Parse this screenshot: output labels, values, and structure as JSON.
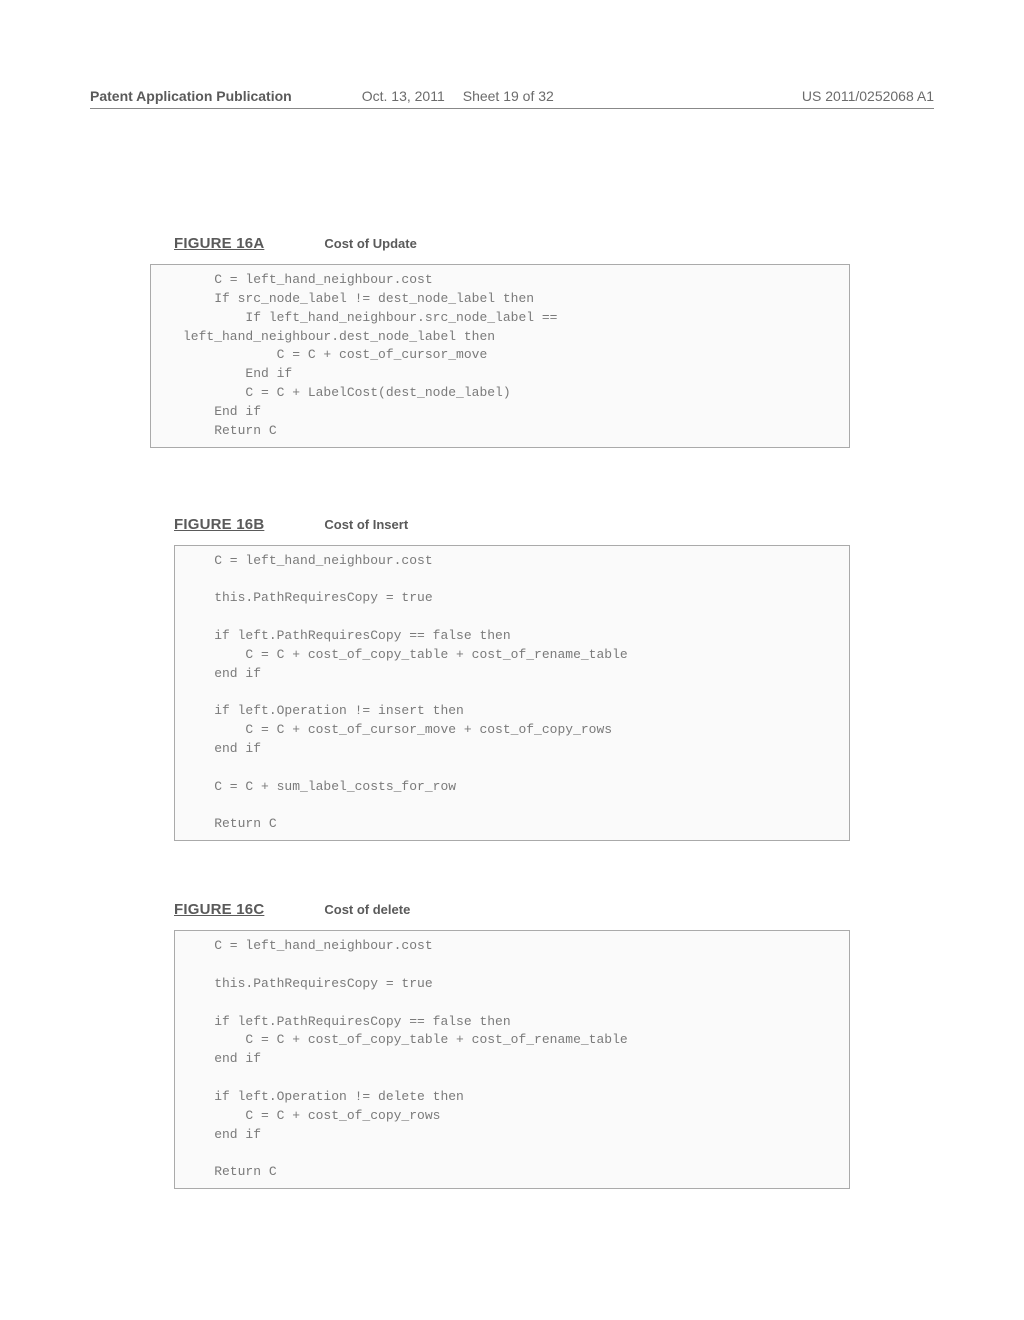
{
  "header": {
    "pub_type": "Patent Application Publication",
    "date": "Oct. 13, 2011",
    "sheet": "Sheet 19 of 32",
    "pubno": "US 2011/0252068 A1"
  },
  "figures": [
    {
      "label": "FIGURE 16A",
      "caption": "Cost of Update",
      "code": "    C = left_hand_neighbour.cost\n    If src_node_label != dest_node_label then\n        If left_hand_neighbour.src_node_label ==\nleft_hand_neighbour.dest_node_label then\n            C = C + cost_of_cursor_move\n        End if\n        C = C + LabelCost(dest_node_label)\n    End if\n    Return C"
    },
    {
      "label": "FIGURE 16B",
      "caption": "Cost of Insert",
      "code": "    C = left_hand_neighbour.cost\n\n    this.PathRequiresCopy = true\n\n    if left.PathRequiresCopy == false then\n        C = C + cost_of_copy_table + cost_of_rename_table\n    end if\n\n    if left.Operation != insert then\n        C = C + cost_of_cursor_move + cost_of_copy_rows\n    end if\n\n    C = C + sum_label_costs_for_row\n\n    Return C"
    },
    {
      "label": "FIGURE 16C",
      "caption": "Cost of delete",
      "code": "    C = left_hand_neighbour.cost\n\n    this.PathRequiresCopy = true\n\n    if left.PathRequiresCopy == false then\n        C = C + cost_of_copy_table + cost_of_rename_table\n    end if\n\n    if left.Operation != delete then\n        C = C + cost_of_copy_rows\n    end if\n\n    Return C"
    }
  ]
}
